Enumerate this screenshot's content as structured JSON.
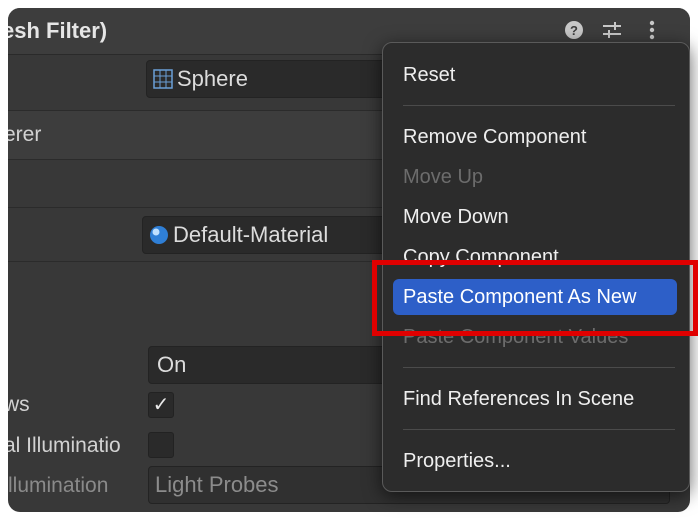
{
  "header": {
    "title": "esh Filter)"
  },
  "mesh": {
    "value": "Sphere"
  },
  "renderer_header": {
    "title": "erer"
  },
  "material": {
    "value": "Default-Material"
  },
  "cast_shadows": {
    "value": "On"
  },
  "rows": {
    "receive_shadows_label": "ws",
    "gi_label": "al Illuminatio",
    "gi2_label": "llumination",
    "gi2_value": "Light Probes"
  },
  "menu": {
    "reset": "Reset",
    "remove": "Remove Component",
    "move_up": "Move Up",
    "move_down": "Move Down",
    "copy": "Copy Component",
    "paste_new": "Paste Component As New",
    "paste_values": "Paste Component Values",
    "find_refs": "Find References In Scene",
    "properties": "Properties..."
  },
  "colors": {
    "highlight": "#2d5fc8",
    "callout": "#e00000",
    "panel": "#383838"
  }
}
